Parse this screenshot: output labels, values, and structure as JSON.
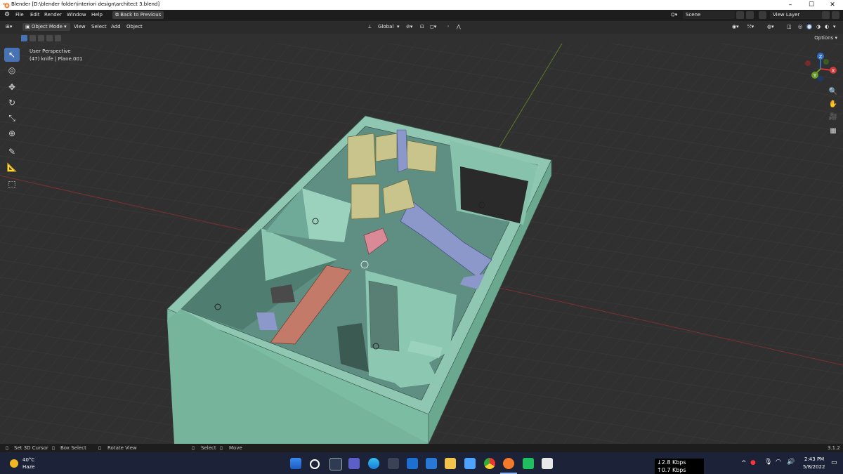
{
  "window": {
    "title": "Blender [D:\\blender folder\\interiori design\\architect 3.blend]",
    "minimize": "–",
    "maximize": "☐",
    "close": "✕"
  },
  "menu": {
    "items": [
      "File",
      "Edit",
      "Render",
      "Window",
      "Help"
    ],
    "back_button": "Back to Previous",
    "scene_label": "Scene",
    "view_layer_label": "View Layer"
  },
  "viewport_header": {
    "mode": "Object Mode",
    "items": [
      "View",
      "Select",
      "Add",
      "Object"
    ],
    "orientation": "Global",
    "options": "Options"
  },
  "viewport": {
    "perspective": "User Perspective",
    "object_info": "(47) knife | Plane.001"
  },
  "gizmo": {
    "x": "X",
    "y": "Y",
    "z": "Z"
  },
  "statusbar": {
    "items": [
      "Set 3D Cursor",
      "Box Select",
      "Rotate View",
      "Select",
      "Move"
    ],
    "version": "3.1.2"
  },
  "taskbar": {
    "temperature": "40°C",
    "weather": "Haze",
    "net_down": "2.8 Kbps",
    "net_up": "0.7 Kbps",
    "time": "2:43 PM",
    "date": "5/8/2022"
  },
  "colors": {
    "accent": "#4772b3",
    "wall": "#7fbfa6",
    "background": "#303030"
  }
}
